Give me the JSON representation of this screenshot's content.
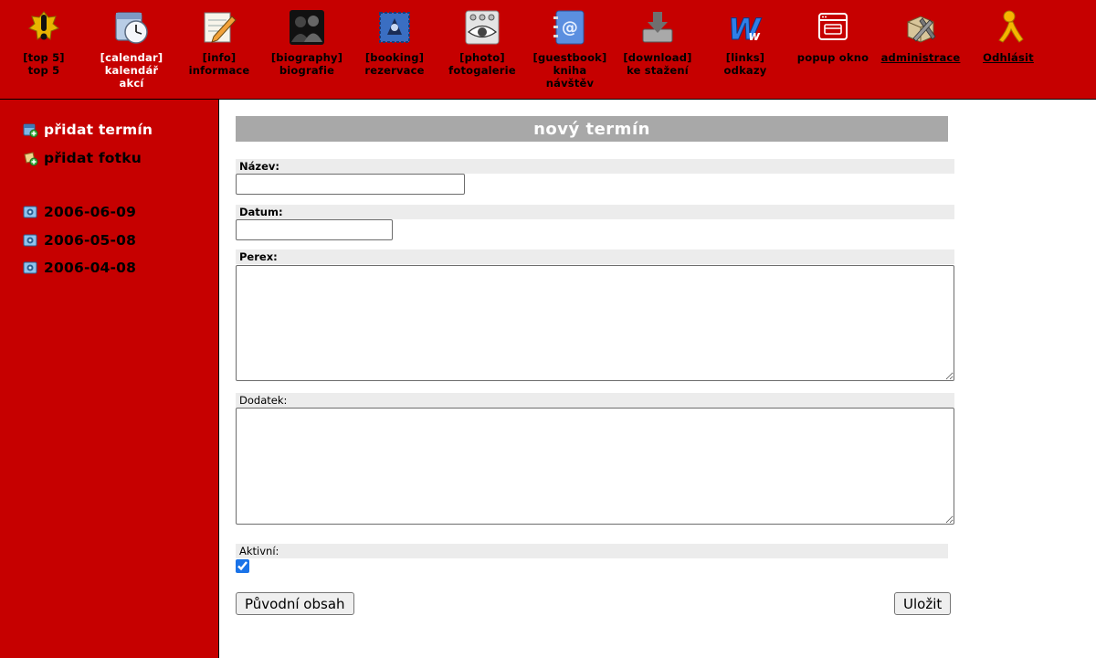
{
  "nav": {
    "items": [
      {
        "line1": "[top 5]",
        "line2": "top 5",
        "icon": "exclamation-icon"
      },
      {
        "line1": "[calendar]",
        "line2": "kalendář",
        "line3": "akcí",
        "icon": "calendar-clock-icon",
        "active": true
      },
      {
        "line1": "[info]",
        "line2": "informace",
        "icon": "notepad-pencil-icon"
      },
      {
        "line1": "[biography]",
        "line2": "biografie",
        "icon": "people-silhouette-icon"
      },
      {
        "line1": "[booking]",
        "line2": "rezervace",
        "icon": "booking-stamp-icon"
      },
      {
        "line1": "[photo]",
        "line2": "fotogalerie",
        "icon": "photo-eye-icon"
      },
      {
        "line1": "[guestbook]",
        "line2": "kniha",
        "line3": "návštěv",
        "icon": "address-book-icon"
      },
      {
        "line1": "[download]",
        "line2": "ke stažení",
        "icon": "download-tray-icon"
      },
      {
        "line1": "[links]",
        "line2": "odkazy",
        "icon": "links-w-icon"
      },
      {
        "line1": "popup okno",
        "icon": "popup-window-icon"
      },
      {
        "line1": "administrace",
        "icon": "admin-tools-icon"
      },
      {
        "line1": "Odhlásit",
        "icon": "logout-figure-icon"
      }
    ]
  },
  "sidebar": {
    "actions": [
      {
        "label": "přidat termín",
        "icon": "add-date-icon"
      },
      {
        "label": "přidat fotku",
        "icon": "add-photo-icon"
      }
    ],
    "dates": [
      {
        "label": "2006-06-09",
        "icon": "photo-album-icon"
      },
      {
        "label": "2006-05-08",
        "icon": "photo-album-icon"
      },
      {
        "label": "2006-04-08",
        "icon": "photo-album-icon"
      }
    ]
  },
  "form": {
    "title": "nový termín",
    "name_label": "Název:",
    "name_value": "",
    "date_label": "Datum:",
    "date_value": "",
    "perex_label": "Perex:",
    "perex_value": "",
    "addendum_label": "Dodatek:",
    "addendum_value": "",
    "active_label": "Aktivní:",
    "active_checked": true,
    "reset_button": "Původní obsah",
    "save_button": "Uložit"
  },
  "colors": {
    "brand_red": "#c60000",
    "title_bar_gray": "#a8a8a8",
    "label_bg": "#ececec"
  }
}
